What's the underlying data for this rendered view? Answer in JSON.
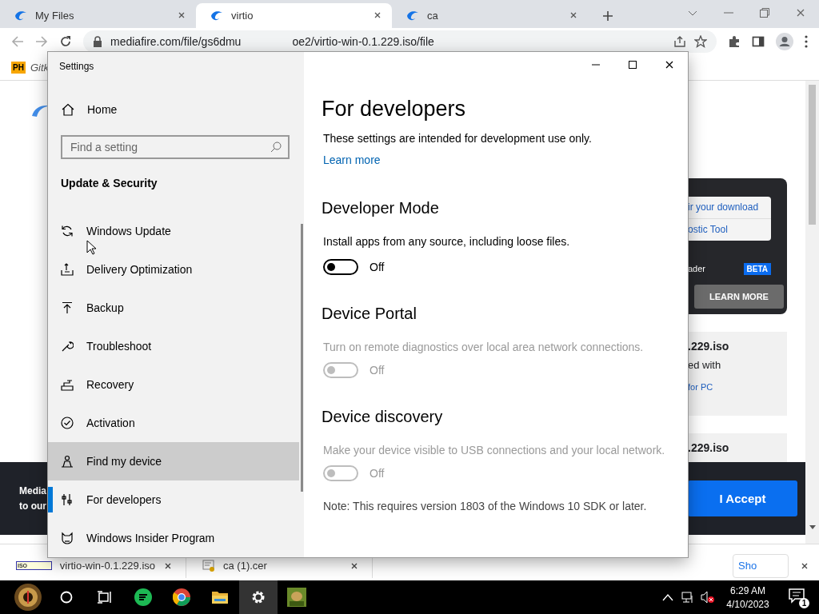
{
  "browser": {
    "tabs": [
      {
        "label": "My Files",
        "selected": false
      },
      {
        "label": "virtio",
        "selected": true
      },
      {
        "label": "ca",
        "selected": false
      }
    ],
    "address": [
      "mediafire.com/file/gs6dmu",
      "oe2/virtio-win-0.1.229.iso/file"
    ],
    "bookmarks": [
      {
        "badge": "PH",
        "label": "Gitk"
      }
    ],
    "page": {
      "card_links": [
        "ir your download",
        "ostic Tool"
      ],
      "reader": "ader",
      "beta": "BETA",
      "learn_more": "LEARN MORE",
      "file_cards": [
        {
          "title": ".229.iso",
          "text": "ed with",
          "link": "for PC"
        },
        {
          "title": ".229.iso"
        }
      ],
      "banner": {
        "lines": [
          "Media",
          "to our"
        ],
        "accept": "I Accept"
      }
    },
    "downloads": {
      "items": [
        {
          "badge": "ISO",
          "name": "virtio-win-0.1.229.iso"
        },
        {
          "name": "ca (1).cer"
        }
      ],
      "show_all": "Sho"
    }
  },
  "settings": {
    "title": "Settings",
    "home": "Home",
    "search_placeholder": "Find a setting",
    "group": "Update & Security",
    "nav": [
      {
        "label": "Windows Update",
        "selected": false,
        "hovered": false
      },
      {
        "label": "Delivery Optimization",
        "selected": false,
        "hovered": false
      },
      {
        "label": "Backup",
        "selected": false,
        "hovered": false
      },
      {
        "label": "Troubleshoot",
        "selected": false,
        "hovered": false
      },
      {
        "label": "Recovery",
        "selected": false,
        "hovered": false
      },
      {
        "label": "Activation",
        "selected": false,
        "hovered": false
      },
      {
        "label": "Find my device",
        "selected": false,
        "hovered": true
      },
      {
        "label": "For developers",
        "selected": true,
        "hovered": false
      },
      {
        "label": "Windows Insider Program",
        "selected": false,
        "hovered": false
      }
    ],
    "heading": "For developers",
    "intro": "These settings are intended for development use only.",
    "learn_more": "Learn more",
    "sections": [
      {
        "title": "Developer Mode",
        "description": "Install apps from any source, including loose files.",
        "toggle": {
          "on": false,
          "disabled": false,
          "label": "Off"
        }
      },
      {
        "title": "Device Portal",
        "description": "Turn on remote diagnostics over local area network connections.",
        "toggle": {
          "on": false,
          "disabled": true,
          "label": "Off"
        }
      },
      {
        "title": "Device discovery",
        "description": "Make your device visible to USB connections and your local network.",
        "toggle": {
          "on": false,
          "disabled": true,
          "label": "Off"
        }
      }
    ],
    "note": "Note: This requires version 1803 of the Windows 10 SDK or later."
  },
  "taskbar": {
    "time": "6:29 AM",
    "date": "4/10/2023",
    "notifications": "1"
  }
}
